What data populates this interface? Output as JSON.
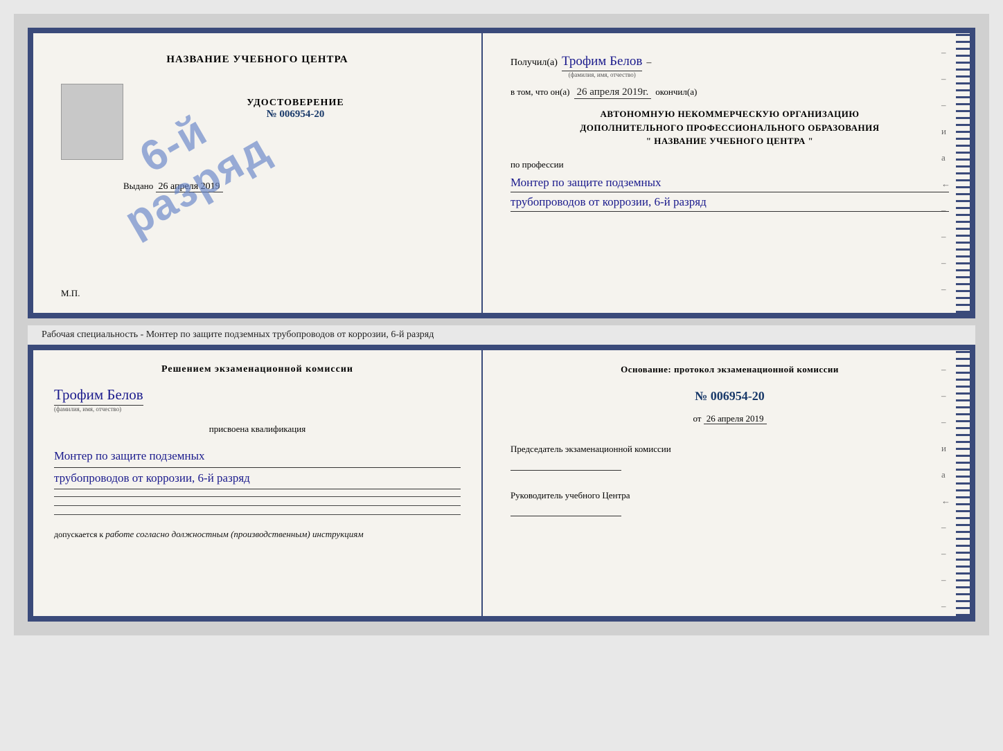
{
  "page": {
    "background": "#d0d0d0"
  },
  "cert_top": {
    "left": {
      "title": "НАЗВАНИЕ УЧЕБНОГО ЦЕНТРА",
      "stamp_line1": "6-й",
      "stamp_line2": "разряд",
      "udost_title": "УДОСТОВЕРЕНИЕ",
      "udost_num": "№ 006954-20",
      "vydano_label": "Выдано",
      "vydano_date": "26 апреля 2019",
      "mp": "М.П."
    },
    "right": {
      "poluchil_label": "Получил(а)",
      "fio_hw": "Трофим Белов",
      "fio_small": "(фамилия, имя, отчество)",
      "dash": "–",
      "vtom_label": "в том, что он(а)",
      "date_hw": "26 апреля 2019г.",
      "okonchil": "окончил(а)",
      "org_line1": "АВТОНОМНУЮ НЕКОММЕРЧЕСКУЮ ОРГАНИЗАЦИЮ",
      "org_line2": "ДОПОЛНИТЕЛЬНОГО ПРОФЕССИОНАЛЬНОГО ОБРАЗОВАНИЯ",
      "org_line3": "\" НАЗВАНИЕ УЧЕБНОГО ЦЕНТРА \"",
      "i_label": "и",
      "a_label": "а",
      "arrow_label": "←",
      "po_professii": "по профессии",
      "profession_hw_1": "Монтер по защите подземных",
      "profession_hw_2": "трубопроводов от коррозии, 6-й разряд",
      "dashes": [
        "–",
        "–",
        "–"
      ]
    }
  },
  "middle": {
    "label": "Рабочая специальность - Монтер по защите подземных трубопроводов от коррозии, 6-й разряд"
  },
  "cert_bottom": {
    "left": {
      "resheniyem": "Решением экзаменационной комиссии",
      "fio_hw": "Трофим Белов",
      "fio_small": "(фамилия, имя, отчество)",
      "prisvoena": "присвоена квалификация",
      "profession_hw_1": "Монтер по защите подземных",
      "profession_hw_2": "трубопроводов от коррозии, 6-й разряд",
      "dopuskaetsya_label": "допускается к",
      "dopuskaetsya_val": "работе согласно должностным (производственным) инструкциям"
    },
    "right": {
      "osnovaniye": "Основание: протокол экзаменационной комиссии",
      "protocol_num": "№ 006954-20",
      "ot_label": "от",
      "protocol_date": "26 апреля 2019",
      "predsedatel_label": "Председатель экзаменационной комиссии",
      "rukovoditel_label": "Руководитель учебного Центра",
      "dashes": [
        "–",
        "–",
        "–",
        "и",
        "а",
        "←",
        "–",
        "–",
        "–",
        "–"
      ]
    }
  }
}
